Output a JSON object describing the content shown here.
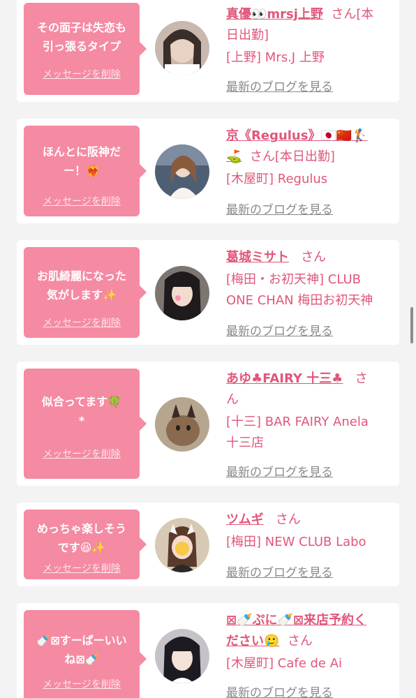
{
  "items": [
    {
      "message": "その面子は失恋も\n引っ張るタイプ",
      "delete_label": "メッセージを削除",
      "line1": "真優👀mrsj上野",
      "suffix1": "さん[本",
      "line2": "日出勤]",
      "shop1": "[上野] Mrs.J 上野",
      "shop2": "",
      "blog_label": "最新のブログを見る"
    },
    {
      "message": "ほんとに阪神だ\nー！❤‍🔥",
      "delete_label": "メッセージを削除",
      "line1": "京《Regulus》🇯🇵🇨🇳🏌",
      "suffix1": "",
      "line2_name": "⛳",
      "line2": "さん[本日出勤]",
      "shop1": "[木屋町] Regulus",
      "shop2": "",
      "blog_label": "最新のブログを見る"
    },
    {
      "message": "お肌綺麗になった\n気がします✨",
      "delete_label": "メッセージを削除",
      "line1": "葛城ミサト",
      "suffix1": "さん",
      "line2": "",
      "shop1": "[梅田・お初天神] CLUB",
      "shop2": "ONE CHAN 梅田お初天神",
      "blog_label": "最新のブログを見る"
    },
    {
      "message": "似合ってます🍀\n*",
      "delete_label": "メッセージを削除",
      "line1": "あゆ♣FAIRY 十三♣",
      "suffix1": "さ",
      "line2": "ん",
      "shop1": "[十三] BAR FAIRY Anela",
      "shop2": "十三店",
      "blog_label": "最新のブログを見る"
    },
    {
      "message": "めっちゃ楽しそう\nです😆✨",
      "delete_label": "メッセージを削除",
      "line1": "ツムギ",
      "suffix1": "さん",
      "line2": "",
      "shop1": "[梅田] NEW CLUB Labo",
      "shop2": "",
      "blog_label": "最新のブログを見る"
    },
    {
      "message": "🍼⊠すーぱーいい\nね⊠🍼",
      "delete_label": "メッセージを削除",
      "line1": "⊠🍼ぷに🍼⊠来店予約く",
      "suffix1": "",
      "line2_name": "ださい🥲",
      "line2": "さん",
      "shop1": "[木屋町] Cafe de Ai",
      "shop2": "",
      "blog_label": "最新のブログを見る"
    }
  ],
  "colors": {
    "accent": "#e0577a",
    "bubble": "#f58aa3",
    "muted": "#8a8a8a"
  }
}
